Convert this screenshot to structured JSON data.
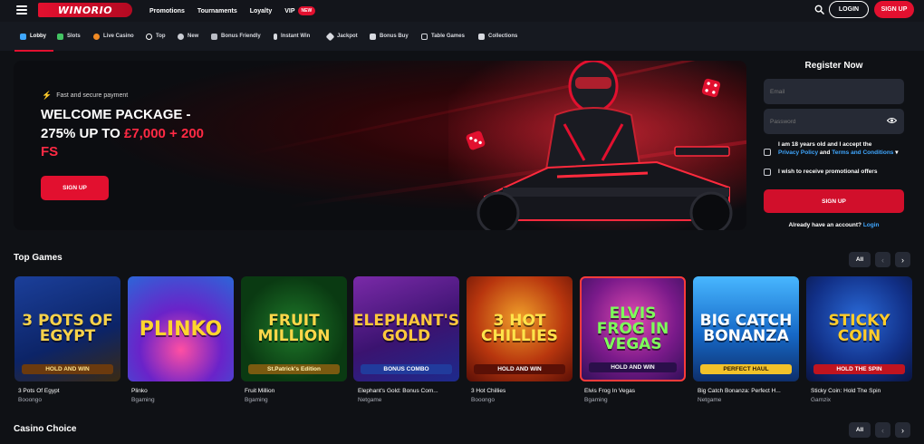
{
  "header": {
    "logo_text": "WINORIO",
    "nav": [
      "Promotions",
      "Tournaments",
      "Loyalty",
      "VIP"
    ],
    "vip_badge": "NEW",
    "login_label": "LOGIN",
    "signup_label": "SIGN UP"
  },
  "categories": [
    {
      "label": "Lobby",
      "icon": "lobby-icon",
      "active": true
    },
    {
      "label": "Slots",
      "icon": "slots-icon"
    },
    {
      "label": "Live Casino",
      "icon": "live-casino-icon"
    },
    {
      "label": "Top",
      "icon": "top-icon"
    },
    {
      "label": "New",
      "icon": "new-icon"
    },
    {
      "label": "Bonus Friendly",
      "icon": "bonus-friendly-icon"
    },
    {
      "label": "Instant Win",
      "icon": "instant-win-icon"
    },
    {
      "label": "Jackpot",
      "icon": "jackpot-icon"
    },
    {
      "label": "Bonus Buy",
      "icon": "bonus-buy-icon"
    },
    {
      "label": "Table Games",
      "icon": "table-games-icon"
    },
    {
      "label": "Collections",
      "icon": "collections-icon"
    }
  ],
  "hero": {
    "subtitle": "Fast and secure payment",
    "title_line1": "WELCOME PACKAGE -",
    "title_line2_prefix": "275% UP TO ",
    "title_line2_highlight": "£7,000 + 200",
    "title_line3": "FS",
    "button_label": "SIGN UP"
  },
  "register": {
    "title": "Register Now",
    "email_placeholder": "Email",
    "password_placeholder": "Password",
    "terms_text_1": "I am 18 years old and I accept the",
    "privacy_link": "Privacy Policy",
    "terms_and": " and ",
    "terms_link": "Terms and Conditions",
    "promo_text": "I wish to receive promotional offers",
    "submit_label": "SIGN UP",
    "footer_text": "Already have an account? ",
    "footer_link": "Login"
  },
  "top_games": {
    "title": "Top Games",
    "all_label": "All",
    "games": [
      {
        "name": "3 Pots Of Egypt",
        "provider": "Booongo"
      },
      {
        "name": "Plinko",
        "provider": "Bgaming"
      },
      {
        "name": "Fruit Million",
        "provider": "Bgaming"
      },
      {
        "name": "Elephant's Gold: Bonus Com...",
        "provider": "Netgame"
      },
      {
        "name": "3 Hot Chillies",
        "provider": "Booongo"
      },
      {
        "name": "Elvis Frog In Vegas",
        "provider": "Bgaming"
      },
      {
        "name": "Big Catch Bonanza: Perfect H...",
        "provider": "Netgame"
      },
      {
        "name": "Sticky Coin: Hold The Spin",
        "provider": "Gamzix"
      }
    ],
    "art": [
      {
        "title": "3 POTS OF EGYPT",
        "sub": "HOLD AND WIN"
      },
      {
        "title": "PLINKO",
        "sub": ""
      },
      {
        "title": "FRUIT MILLION",
        "sub": "St.Patrick's Edition"
      },
      {
        "title": "ELEPHANT'S GOLD",
        "sub": "BONUS COMBO"
      },
      {
        "title": "3 HOT CHILLIES",
        "sub": "HOLD AND WIN"
      },
      {
        "title": "ELVIS FROG IN VEGAS",
        "sub": "HOLD AND WIN"
      },
      {
        "title": "BIG CATCH BONANZA",
        "sub": "PERFECT HAUL"
      },
      {
        "title": "STICKY COIN",
        "sub": "HOLD THE SPIN"
      }
    ]
  },
  "casino_choice": {
    "title": "Casino Choice",
    "all_label": "All"
  },
  "colors": {
    "accent": "#e2102f",
    "link": "#3fa7ff",
    "background": "#0f1115"
  }
}
